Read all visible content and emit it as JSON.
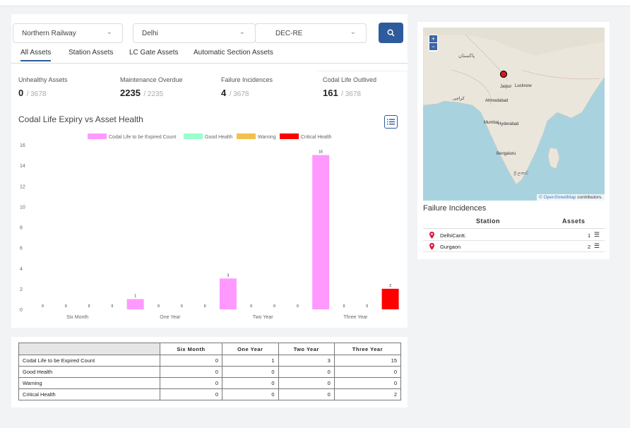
{
  "filters": {
    "zone": "Northern Railway",
    "division": "Delhi",
    "section": "DEC-RE"
  },
  "tabs": [
    {
      "label": "All Assets",
      "active": true
    },
    {
      "label": "Station Assets",
      "active": false
    },
    {
      "label": "LC Gate Assets",
      "active": false
    },
    {
      "label": "Automatic Section Assets",
      "active": false
    }
  ],
  "stats": [
    {
      "label": "Unhealthy Assets",
      "value": "0",
      "total": "/ 3678"
    },
    {
      "label": "Maintenance Overdue",
      "value": "2235",
      "total": "/ 2235"
    },
    {
      "label": "Failure Incidences",
      "value": "4",
      "total": "/ 3678"
    },
    {
      "label": "Codal Life Outlived",
      "value": "161",
      "total": "/ 3678"
    }
  ],
  "chart_title": "Codal Life Expiry vs Asset Health",
  "chart_data": {
    "type": "bar",
    "categories": [
      "Six Month",
      "One Year",
      "Two Year",
      "Three Year"
    ],
    "series": [
      {
        "name": "Codal Life to be Expired Count",
        "color": "#ff99ff",
        "values": [
          0,
          1,
          3,
          15
        ]
      },
      {
        "name": "Good Health",
        "color": "#99ffcc",
        "values": [
          0,
          0,
          0,
          0
        ]
      },
      {
        "name": "Warning",
        "color": "#f0c050",
        "values": [
          0,
          0,
          0,
          0
        ]
      },
      {
        "name": "Critical Health",
        "color": "#ff0000",
        "values": [
          0,
          0,
          0,
          2
        ]
      }
    ],
    "ylim": [
      0,
      16
    ],
    "yticks": [
      0,
      2,
      4,
      6,
      8,
      10,
      12,
      14,
      16
    ],
    "legend": "top-center",
    "grid": false
  },
  "table": {
    "headers": [
      "",
      "Six Month",
      "One Year",
      "Two Year",
      "Three Year"
    ],
    "rows": [
      [
        "Codal Life to be Expired Count",
        "0",
        "1",
        "3",
        "15"
      ],
      [
        "Good Health",
        "0",
        "0",
        "0",
        "0"
      ],
      [
        "Warning",
        "0",
        "0",
        "0",
        "0"
      ],
      [
        "Critical Health",
        "0",
        "0",
        "0",
        "2"
      ]
    ]
  },
  "map": {
    "zoom_in": "+",
    "zoom_out": "−",
    "labels": {
      "jaipur": "Jaipur",
      "lucknow": "Lucknow",
      "ahmedabad": "Ahmedabad",
      "mumbai": "Mumbai",
      "hyderabad": "Hyderabad",
      "bengaluru": "Bengaluru",
      "karachi": "کراچی",
      "pakistan": "پاکستان",
      "srilanka": "ශ්‍රී ලංකාව"
    },
    "attribution_link": "© OpenStreetMap",
    "attribution_text": " contributors."
  },
  "failure": {
    "title": "Failure Incidences",
    "col_station": "Station",
    "col_assets": "Assets",
    "rows": [
      {
        "station": "DelhiCantt.",
        "assets": "1"
      },
      {
        "station": "Gurgaon",
        "assets": "2"
      }
    ]
  }
}
